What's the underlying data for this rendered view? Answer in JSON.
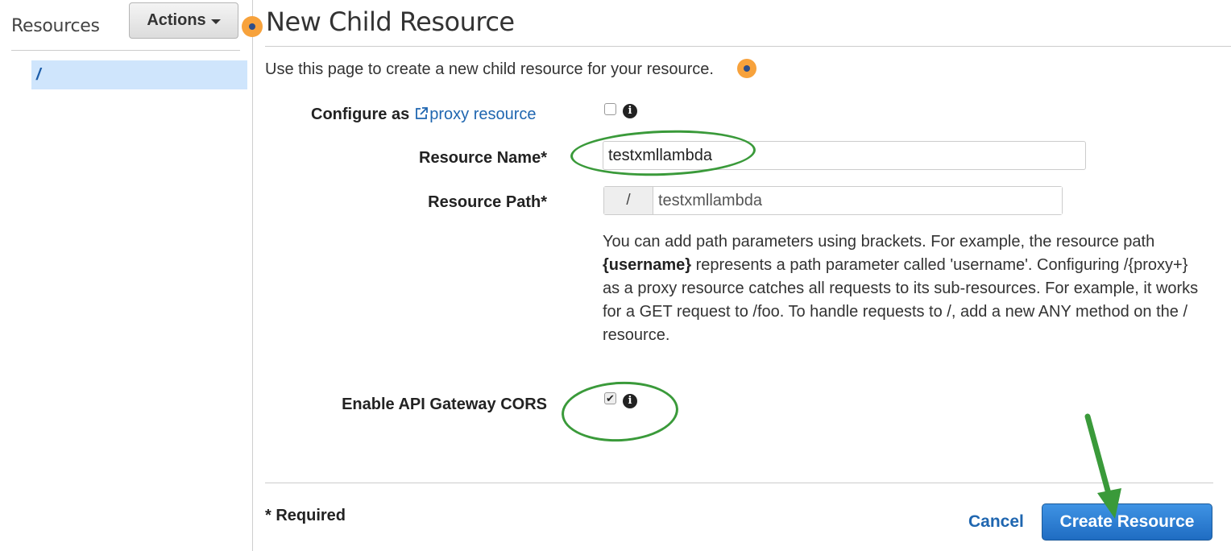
{
  "sidebar": {
    "title": "Resources",
    "actions_label": "Actions",
    "root_item": "/"
  },
  "main": {
    "title": "New Child Resource",
    "intro": "Use this page to create a new child resource for your resource.",
    "configure_label_prefix": "Configure as",
    "proxy_link": "proxy resource",
    "resource_name_label": "Resource Name*",
    "resource_name_value": "testxmllambda",
    "resource_path_label": "Resource Path*",
    "resource_path_prefix": "/",
    "resource_path_value": "testxmllambda",
    "help_part1": "You can add path parameters using brackets. For example, the resource path ",
    "help_bold": "{username}",
    "help_part2": " represents a path parameter called 'username'. Configuring /{proxy+} as a proxy resource catches all requests to its sub-resources. For example, it works for a GET request to /foo. To handle requests to /, add a new ANY method on the / resource.",
    "cors_label": "Enable API Gateway CORS",
    "proxy_checked": false,
    "cors_checked": true,
    "required_note": "* Required",
    "cancel_label": "Cancel",
    "create_label": "Create Resource"
  },
  "icons": {
    "info": "info-icon",
    "external_link": "external-link-icon",
    "help_indicator": "help-dot-icon"
  },
  "colors": {
    "accent": "#1f66b0",
    "primary_button": "#2b7bd3",
    "selected_item": "#cfe5fc",
    "annotation": "#3a9a3a",
    "help_dot": "#f7a23c"
  }
}
